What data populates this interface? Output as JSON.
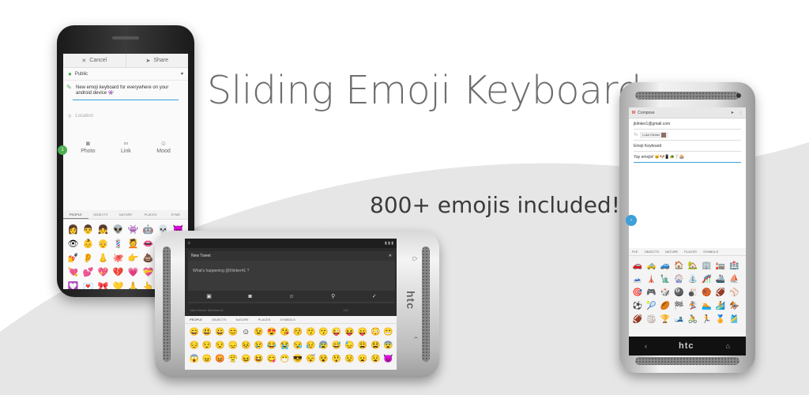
{
  "headline": "Sliding Emoji Keyboard",
  "subline": "800+ emojis included!",
  "colors": {
    "curve": "#e6e6e6",
    "headline": "#6e6e6e",
    "subline": "#3b3b3b",
    "accent_blue": "#3ea0d8",
    "accent_green": "#4caf50",
    "gmail_red": "#db4437"
  },
  "phone1": {
    "cancel_label": "Cancel",
    "share_label": "Share",
    "audience": "Public",
    "post_text": "New emoji keyboard for everywhere on your android device 👾",
    "location_placeholder": "Location",
    "attachments": [
      {
        "label": "Photo",
        "icon": "camera-icon"
      },
      {
        "label": "Link",
        "icon": "link-icon"
      },
      {
        "label": "Mood",
        "icon": "smiley-icon"
      }
    ],
    "tabs": [
      "PEOPLE",
      "OBJECTS",
      "NATURE",
      "PLACES",
      "SYMB"
    ],
    "emojis": [
      "👩",
      "👨",
      "👧",
      "👽",
      "👾",
      "🤖",
      "💀",
      "😈",
      "👁",
      "👶",
      "👴",
      "💈",
      "💆",
      "👄",
      "🎅",
      "🙀",
      "💅",
      "👂",
      "👃",
      "🐙",
      "👉",
      "💩",
      "💧",
      "💙",
      "💘",
      "💕",
      "💖",
      "💔",
      "💗",
      "💝",
      "💞",
      "💓",
      "💟",
      "💌",
      "🎀",
      "💛",
      "🙏",
      "👆",
      "✊",
      "🖐",
      "👊",
      "🙌",
      "👌",
      "👍"
    ],
    "fab_label": "1"
  },
  "phone2": {
    "brand": "htc",
    "dialog_title": "New Tweet",
    "tweet_placeholder": "What's happening @Klinker41 ?",
    "meta_text": "Jake Klinker @klinker41",
    "meta_count": "140",
    "tabs": [
      "PEOPLE",
      "OBJECTS",
      "NATURE",
      "PLACES",
      "SYMBOLS"
    ],
    "emojis": [
      "😄",
      "😃",
      "😀",
      "😊",
      "☺",
      "😉",
      "😍",
      "😘",
      "😚",
      "😗",
      "😙",
      "😜",
      "😝",
      "😛",
      "😳",
      "😁",
      "😔",
      "😌",
      "😒",
      "😞",
      "😣",
      "😢",
      "😂",
      "😭",
      "😪",
      "😥",
      "😰",
      "😅",
      "😓",
      "😩",
      "😫",
      "😨",
      "😱",
      "😠",
      "😡",
      "😤",
      "😖",
      "😆",
      "😋",
      "😷",
      "😎",
      "😴",
      "😵",
      "😲",
      "😟",
      "😦",
      "😧",
      "😈"
    ]
  },
  "phone3": {
    "brand": "htc",
    "app_title": "Compose",
    "from": "jklinker1@gmail.com",
    "to_label": "To",
    "chip_name": "Luke Klinker",
    "subject": "Emoji Keyboard",
    "body_text": "Yay emojis! 🐱🐶📱🐢🍸🎰",
    "tabs": [
      "PLE",
      "OBJECTS",
      "NATURE",
      "PLACES",
      "SYMBOLS"
    ],
    "emojis": [
      "🚗",
      "🚕",
      "🚙",
      "🏠",
      "🏡",
      "🏢",
      "🏣",
      "🏥",
      "🗻",
      "🗼",
      "🗽",
      "🎡",
      "⛲",
      "🎢",
      "🚢",
      "⛵",
      "🎯",
      "🎮",
      "🎲",
      "🎱",
      "🎳",
      "🏀",
      "🏈",
      "⚾",
      "⚽",
      "🎾",
      "🏉",
      "🏁",
      "🏂",
      "🏊",
      "🏄",
      "🏇",
      "🏈",
      "🏐",
      "🏆",
      "🎿",
      "🚴",
      "🏃",
      "🏅",
      "🎽"
    ]
  }
}
